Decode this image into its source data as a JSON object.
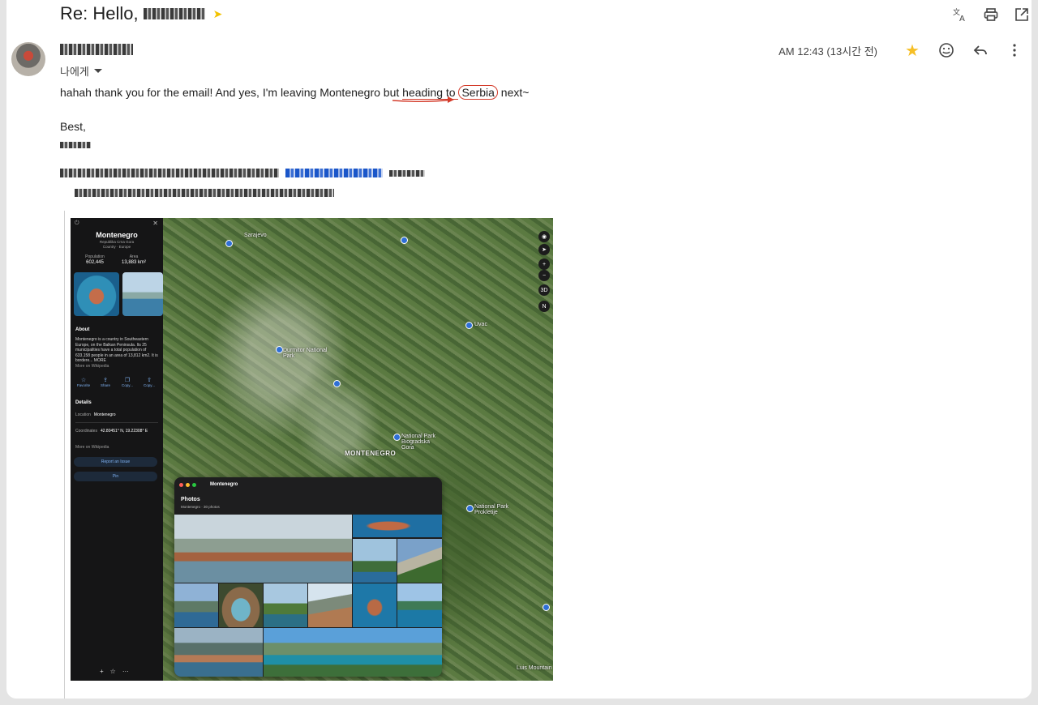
{
  "email": {
    "subject_prefix": "Re: Hello,",
    "time": "AM 12:43 (13시간 전)",
    "to_label": "나에게",
    "body_part1": "hahah thank you for the email! And yes, I'm leaving Montenegro but ",
    "body_underlined": "heading to ",
    "body_circled": "Serbia",
    "body_part2": " next~",
    "signoff": "Best,"
  },
  "icons": {
    "top": [
      "translate-icon",
      "print-icon",
      "open-in-new-icon"
    ],
    "meta": [
      "star-icon",
      "emoji-icon",
      "reply-icon",
      "more-vert-icon"
    ]
  },
  "colors": {
    "star": "#f6bf26",
    "annotation": "#d43b2a",
    "important": "#f2c200"
  },
  "screenshot": {
    "sidebar": {
      "title": "Montenegro",
      "subtitle": "Republika Crna Gora",
      "country_line": "Country · Europe",
      "population_label": "Population",
      "population_value": "602,445",
      "area_label": "Area",
      "area_value": "13,883 km²",
      "about_heading": "About",
      "about_text": "Montenegro is a country in Southeastern Europe, on the Balkan Peninsula. Its 25 municipalities have a total population of 633,158 people in an area of 13,812 km2. It is bordere... MORE",
      "about_source": "More on Wikipedia",
      "actions": [
        "Favorite",
        "Share",
        "Copy...",
        "Copy..."
      ],
      "details_heading": "Details",
      "location_label": "Location",
      "location_value": "Montenegro",
      "coords_label": "Coordinates",
      "coords_value": "42.80451° N, 19.22308° E",
      "coords_source": "More on Wikipedia",
      "report_button": "Report an Issue",
      "pin_button": "Pin"
    },
    "map_labels": {
      "sarajevo": "Sarajevo",
      "montenegro": "MONTENEGRO",
      "np_biogradska": "National Park Biogradska Gora",
      "np_prokletije": "National Park Prokletije",
      "np_durmitor": "Durmitor National Park",
      "uvac": "Uvac",
      "luis_mountain": "Luis Mountain"
    },
    "map_controls": [
      "3D",
      "N"
    ],
    "photos": {
      "window_title": "Montenegro",
      "heading": "Photos",
      "subheading": "Montenegro · 30 photos"
    }
  }
}
